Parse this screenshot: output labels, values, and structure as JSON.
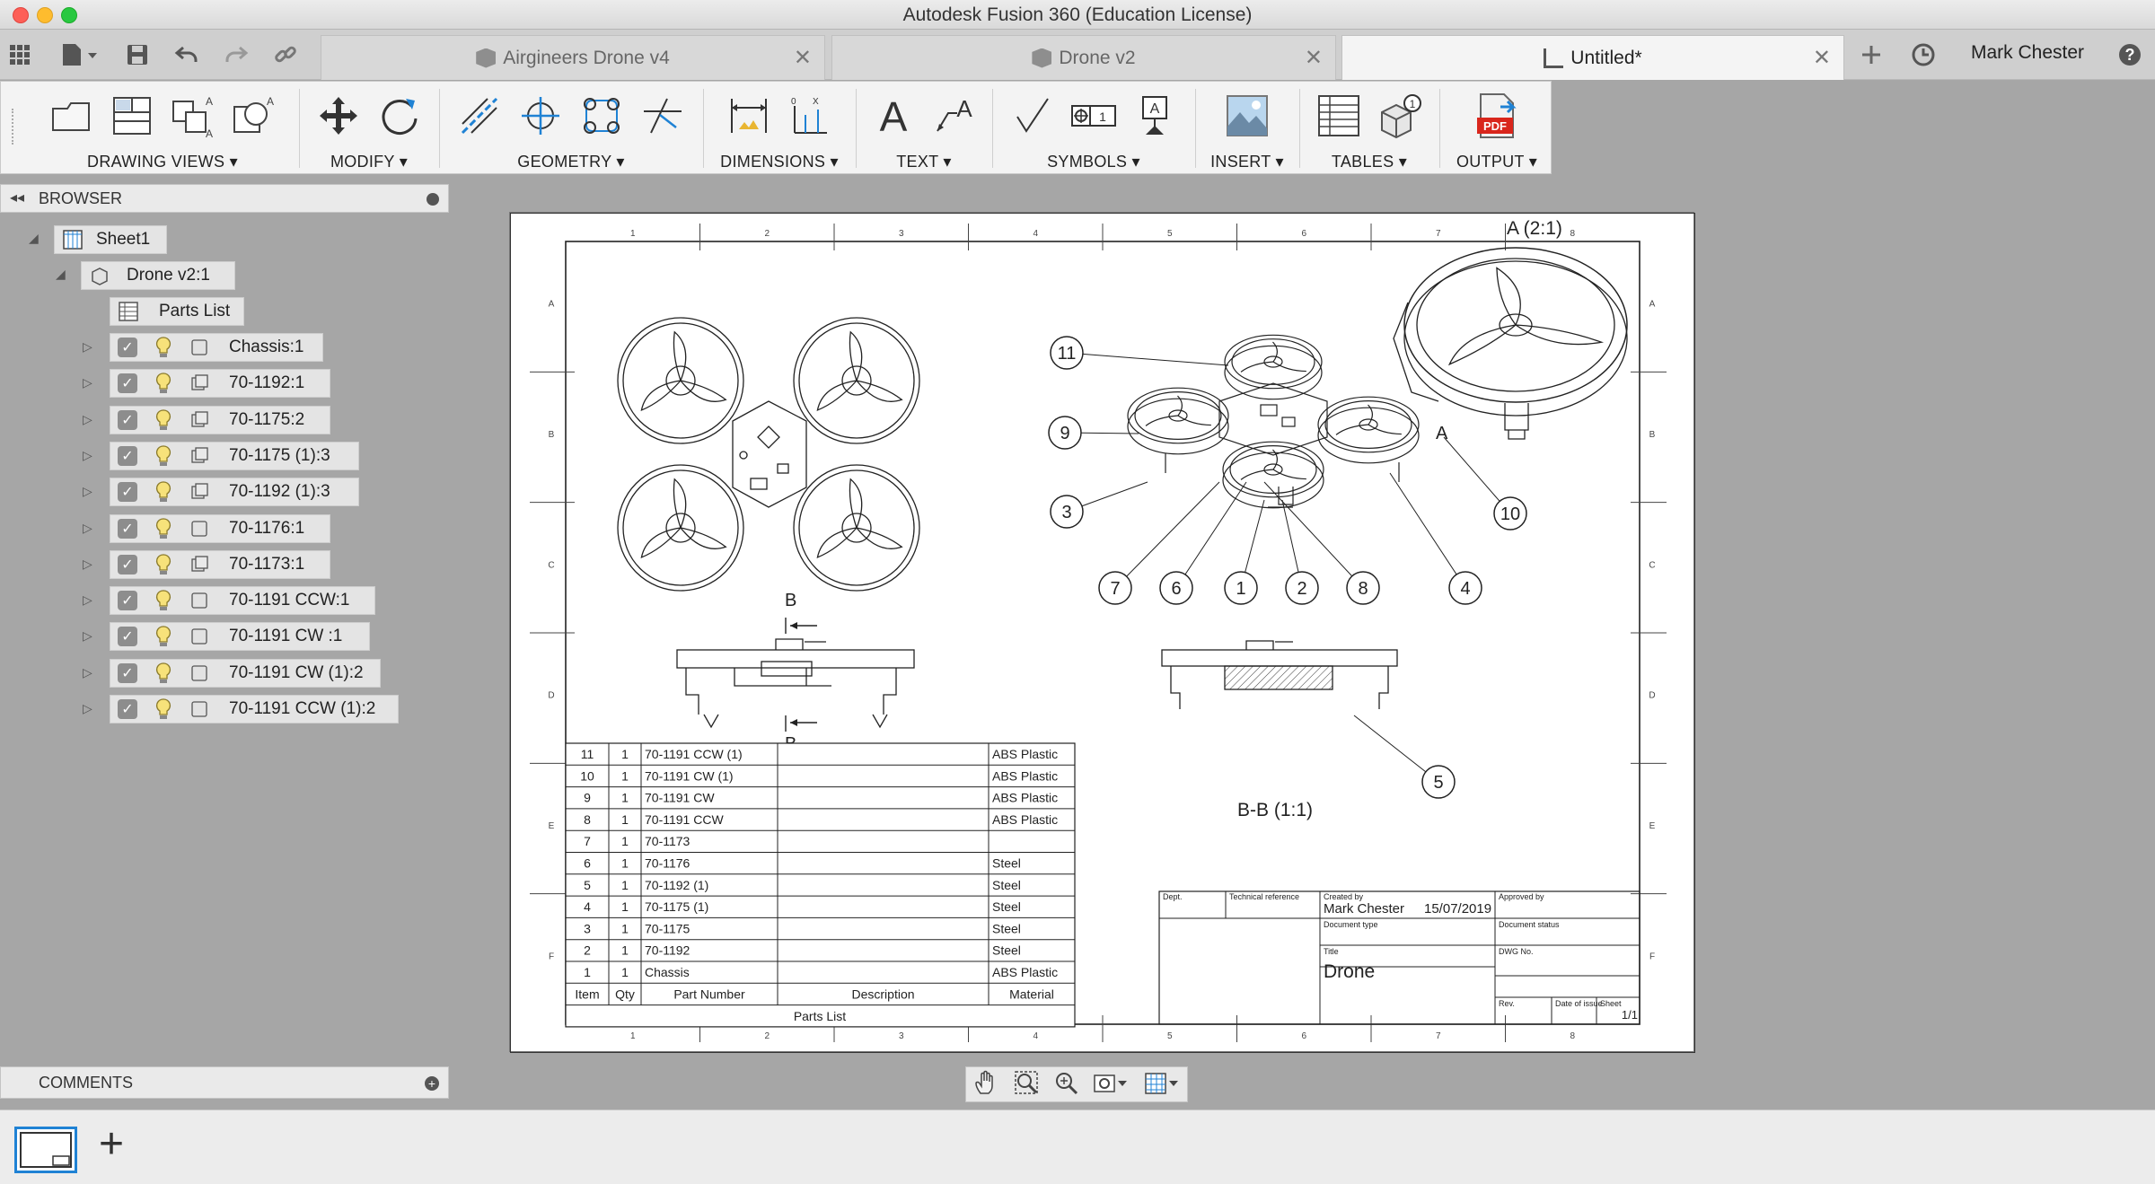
{
  "window": {
    "title": "Autodesk Fusion 360 (Education License)"
  },
  "tabs": [
    {
      "label": "Airgineers Drone v4"
    },
    {
      "label": "Drone v2"
    },
    {
      "label": "Untitled*"
    }
  ],
  "user": {
    "name": "Mark Chester"
  },
  "ribbon": {
    "groups": [
      {
        "label": "DRAWING VIEWS"
      },
      {
        "label": "MODIFY"
      },
      {
        "label": "GEOMETRY"
      },
      {
        "label": "DIMENSIONS"
      },
      {
        "label": "TEXT"
      },
      {
        "label": "SYMBOLS"
      },
      {
        "label": "INSERT"
      },
      {
        "label": "TABLES"
      },
      {
        "label": "OUTPUT"
      }
    ],
    "pdf_label": "PDF"
  },
  "browser": {
    "title": "BROWSER",
    "sheet": "Sheet1",
    "view": "Drone v2:1",
    "parts_list": "Parts List",
    "components": [
      "Chassis:1",
      "70-1192:1",
      "70-1175:2",
      "70-1175 (1):3",
      "70-1192 (1):3",
      "70-1176:1",
      "70-1173:1",
      "70-1191 CCW:1",
      "70-1191 CW :1",
      "70-1191 CW (1):2",
      "70-1191 CCW (1):2"
    ]
  },
  "comments": {
    "title": "COMMENTS"
  },
  "drawing": {
    "col_labels": [
      "1",
      "2",
      "3",
      "4",
      "5",
      "6",
      "7",
      "8"
    ],
    "row_labels": [
      "A",
      "B",
      "C",
      "D",
      "E",
      "F"
    ],
    "detail_label": "A (2:1)",
    "section_label": "B-B (1:1)",
    "section_marker": "B",
    "detail_marker": "A",
    "balloons": [
      "11",
      "9",
      "3",
      "7",
      "6",
      "1",
      "2",
      "8",
      "4",
      "10",
      "5"
    ],
    "parts_list": {
      "title": "Parts List",
      "headers": [
        "Item",
        "Qty",
        "Part Number",
        "Description",
        "Material"
      ],
      "rows": [
        [
          "11",
          "1",
          "70-1191 CCW (1)",
          "",
          "ABS Plastic"
        ],
        [
          "10",
          "1",
          "70-1191 CW (1)",
          "",
          "ABS Plastic"
        ],
        [
          "9",
          "1",
          "70-1191 CW",
          "",
          "ABS Plastic"
        ],
        [
          "8",
          "1",
          "70-1191 CCW",
          "",
          "ABS Plastic"
        ],
        [
          "7",
          "1",
          "70-1173",
          "",
          ""
        ],
        [
          "6",
          "1",
          "70-1176",
          "",
          "Steel"
        ],
        [
          "5",
          "1",
          "70-1192 (1)",
          "",
          "Steel"
        ],
        [
          "4",
          "1",
          "70-1175 (1)",
          "",
          "Steel"
        ],
        [
          "3",
          "1",
          "70-1175",
          "",
          "Steel"
        ],
        [
          "2",
          "1",
          "70-1192",
          "",
          "Steel"
        ],
        [
          "1",
          "1",
          "Chassis",
          "",
          "ABS Plastic"
        ]
      ]
    },
    "title_block": {
      "dept_label": "Dept.",
      "tech_ref_label": "Technical reference",
      "created_by_label": "Created by",
      "created_by": "Mark Chester",
      "date": "15/07/2019",
      "approved_by_label": "Approved by",
      "doc_type_label": "Document type",
      "doc_status_label": "Document status",
      "title_label": "Title",
      "title": "Drone",
      "dwg_no_label": "DWG No.",
      "rev_label": "Rev.",
      "date_issue_label": "Date of issue",
      "sheet_label": "Sheet",
      "sheet": "1/1"
    }
  },
  "colors": {
    "accent": "#1f82d4",
    "pdf_red": "#d9261c"
  }
}
